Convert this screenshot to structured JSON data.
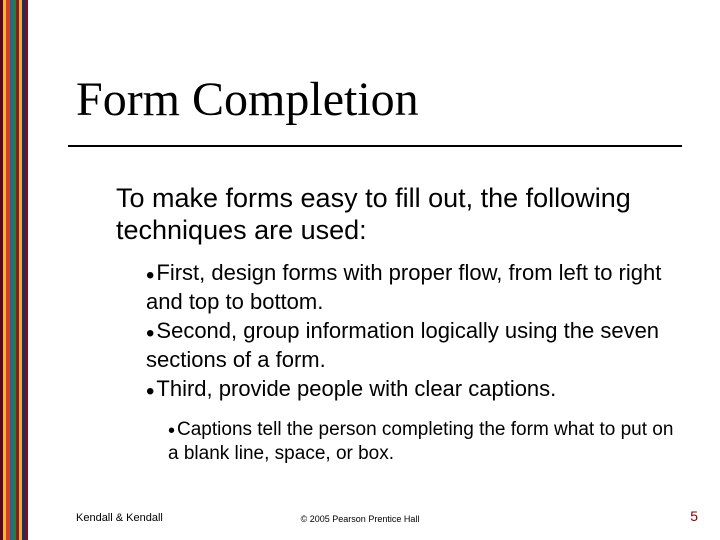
{
  "title": "Form Completion",
  "intro": "To make forms easy to fill out, the following techniques are used:",
  "bullets_level1": [
    "First, design forms with proper flow, from left to right and top to bottom.",
    "Second, group information logically using the seven sections of a form.",
    "Third, provide people with clear captions."
  ],
  "bullets_level2": [
    "Captions tell the person completing the form what to put on a blank line, space, or box."
  ],
  "footer_left": "Kendall & Kendall",
  "footer_center": "© 2005 Pearson Prentice Hall",
  "footer_right": "5",
  "stripe_colors": [
    {
      "c": "#5a071c",
      "w": 3
    },
    {
      "c": "#f5b930",
      "w": 3
    },
    {
      "c": "#d53f2a",
      "w": 4
    },
    {
      "c": "#256b8e",
      "w": 3
    },
    {
      "c": "#2a7a41",
      "w": 3
    },
    {
      "c": "#8a1d1d",
      "w": 3
    },
    {
      "c": "#f2a93a",
      "w": 3
    },
    {
      "c": "#17345f",
      "w": 3
    },
    {
      "c": "#7d0f24",
      "w": 3
    }
  ]
}
